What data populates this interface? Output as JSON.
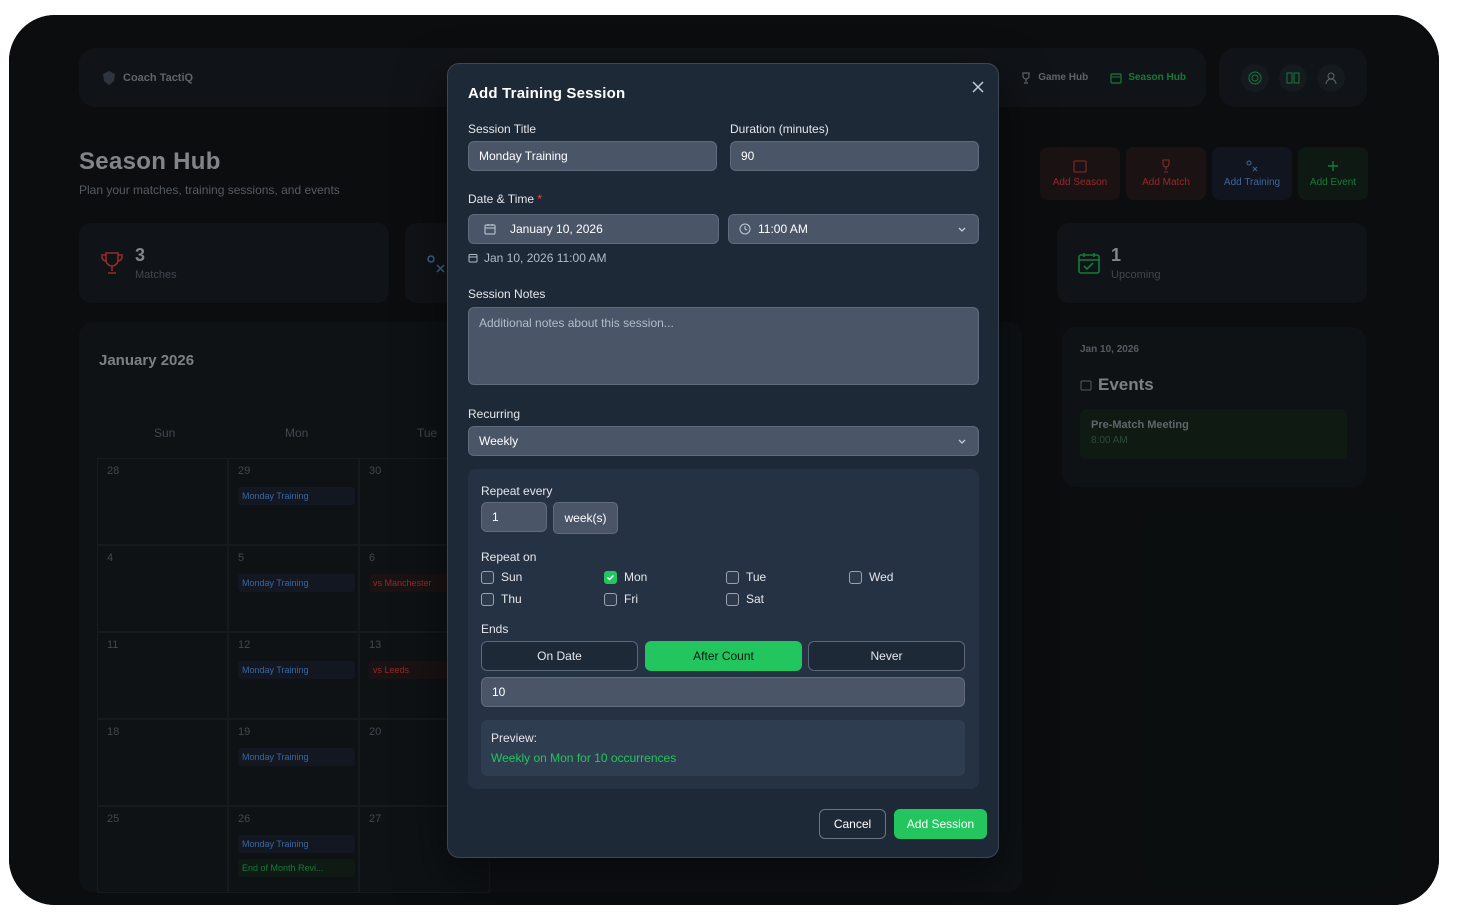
{
  "app": {
    "brand": "Coach TactiQ",
    "nav": {
      "game_hub": "Game Hub",
      "season_hub": "Season Hub"
    },
    "page_title": "Season Hub",
    "page_subtitle": "Plan your matches, training sessions, and events",
    "actions": [
      "Add Season",
      "Add Match",
      "Add Training",
      "Add Event"
    ],
    "stats": [
      {
        "value": "3",
        "label": "Matches"
      },
      {
        "value": "1",
        "label": "Upcoming"
      }
    ],
    "calendar": {
      "title": "January 2026",
      "weekdays": [
        "Sun",
        "Mon",
        "Tue"
      ],
      "weeks": [
        [
          "28",
          "29",
          "30"
        ],
        [
          "4",
          "5",
          "6"
        ],
        [
          "11",
          "12",
          "13"
        ],
        [
          "18",
          "19",
          "20"
        ],
        [
          "25",
          "26",
          "27"
        ]
      ],
      "events": {
        "training": "Monday Training",
        "match_1": "vs Manchester",
        "match_2": "vs Leeds",
        "end_review": "End of Month Revi..."
      }
    },
    "sidebar": {
      "date": "Jan 10, 2026",
      "title": "Events",
      "item_title": "Pre-Match Meeting",
      "item_time": "8:00 AM"
    }
  },
  "modal": {
    "title": "Add Training Session",
    "session_title_label": "Session Title",
    "session_title_value": "Monday Training",
    "duration_label": "Duration (minutes)",
    "duration_value": "90",
    "datetime_label": "Date & Time",
    "required_mark": "*",
    "date_value": "January 10, 2026",
    "time_value": "11:00 AM",
    "datetime_hint": "Jan 10, 2026 11:00 AM",
    "notes_label": "Session Notes",
    "notes_placeholder": "Additional notes about this session...",
    "recurring_label": "Recurring",
    "recurring_value": "Weekly",
    "repeat_every_label": "Repeat every",
    "repeat_every_value": "1",
    "repeat_unit": "week(s)",
    "repeat_on_label": "Repeat on",
    "days": [
      {
        "label": "Sun",
        "checked": false
      },
      {
        "label": "Mon",
        "checked": true
      },
      {
        "label": "Tue",
        "checked": false
      },
      {
        "label": "Wed",
        "checked": false
      },
      {
        "label": "Thu",
        "checked": false
      },
      {
        "label": "Fri",
        "checked": false
      },
      {
        "label": "Sat",
        "checked": false
      }
    ],
    "ends_label": "Ends",
    "ends_options": [
      "On Date",
      "After Count",
      "Never"
    ],
    "ends_selected": "After Count",
    "count_value": "10",
    "preview_label": "Preview:",
    "preview_text": "Weekly on Mon for 10 occurrences",
    "cancel_label": "Cancel",
    "submit_label": "Add Session"
  },
  "colors": {
    "accent": "#22c55e",
    "danger": "#ef4444",
    "info": "#60a5fa",
    "modal_bg": "#1e2938"
  }
}
